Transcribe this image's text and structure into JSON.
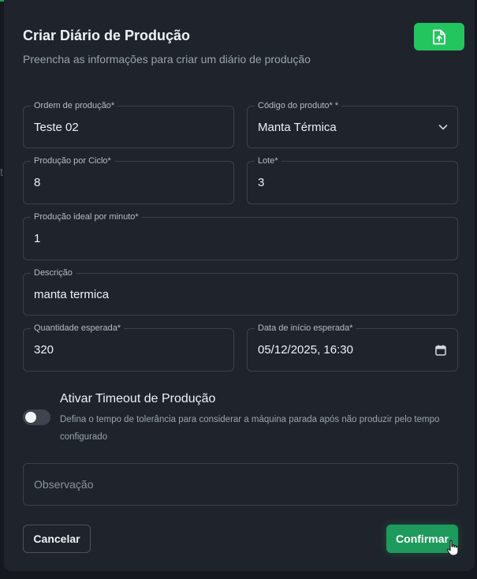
{
  "dialog": {
    "title": "Criar Diário de Produção",
    "subtitle": "Preencha as informações para criar um diário de produção",
    "upload_icon": "file-upload-icon"
  },
  "fields": {
    "ordem": {
      "label": "Ordem de produção*",
      "value": "Teste 02"
    },
    "codigo": {
      "label": "Código do produto* *",
      "value": "Manta Térmica"
    },
    "producao_ciclo": {
      "label": "Produção por Ciclo*",
      "value": "8"
    },
    "lote": {
      "label": "Lote*",
      "value": "3"
    },
    "producao_ideal": {
      "label": "Produção ideal por minuto*",
      "value": "1"
    },
    "descricao": {
      "label": "Descrição",
      "value": "manta termica"
    },
    "quantidade": {
      "label": "Quantidade esperada*",
      "value": "320"
    },
    "data_inicio": {
      "label": "Data de início esperada*",
      "value": "05/12/2025, 16:30"
    },
    "observacao": {
      "placeholder": "Observação"
    }
  },
  "timeout": {
    "title": "Ativar Timeout de Produção",
    "description": "Defina o tempo de tolerância para considerar a máquina parada após não produzir pelo tempo configurado",
    "enabled": false
  },
  "actions": {
    "cancel": "Cancelar",
    "confirm": "Confirmar"
  },
  "colors": {
    "accent": "#22c55e",
    "confirm": "#1e9a5c",
    "background": "#1f242c"
  },
  "backdrop": {
    "edge_text": "t"
  }
}
